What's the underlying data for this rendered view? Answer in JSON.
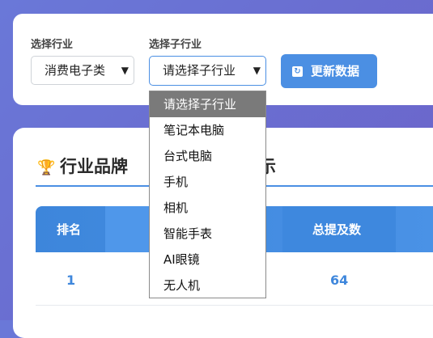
{
  "filters": {
    "industry_label": "选择行业",
    "industry_value": "消费电子类",
    "subindustry_label": "选择子行业",
    "subindustry_value": "请选择子行业",
    "refresh_button": "更新数据",
    "refresh_icon": "refresh-icon"
  },
  "dropdown": {
    "options": [
      "请选择子行业",
      "笔记本电脑",
      "台式电脑",
      "手机",
      "相机",
      "智能手表",
      "AI眼镜",
      "无人机"
    ],
    "selected": "请选择子行业"
  },
  "ranking": {
    "title_icon": "trophy-icon",
    "title_prefix": "行业品牌",
    "title_suffix": "示",
    "columns": [
      "排名",
      "总提及数"
    ],
    "rows": [
      {
        "rank": "1",
        "mentions": "64"
      }
    ]
  },
  "colors": {
    "accent": "#4b8fe3",
    "background": "#6a70d2"
  }
}
